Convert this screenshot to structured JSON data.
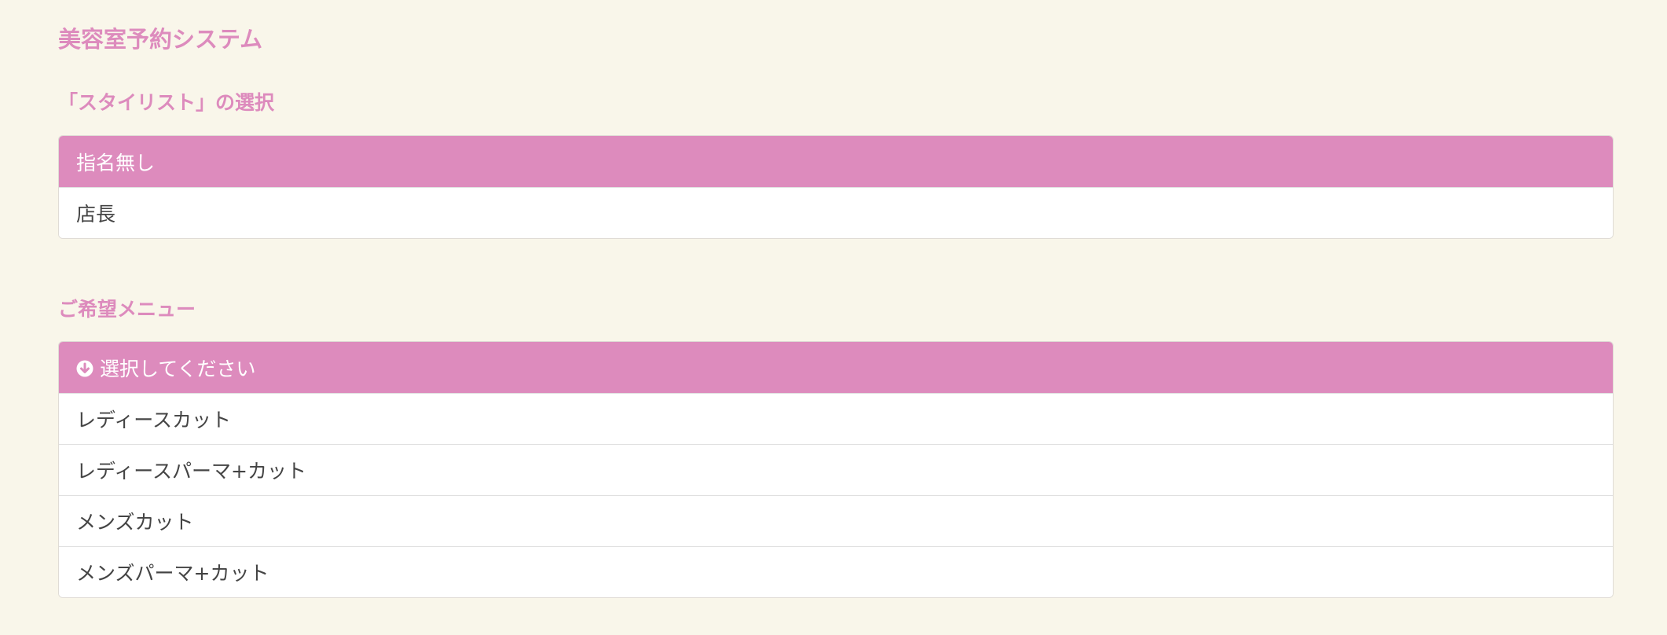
{
  "app": {
    "title": "美容室予約システム"
  },
  "stylist_section": {
    "title": "「スタイリスト」の選択",
    "items": [
      {
        "label": "指名無し",
        "selected": true
      },
      {
        "label": "店長",
        "selected": false
      }
    ]
  },
  "menu_section": {
    "title": "ご希望メニュー",
    "header": {
      "label": "選択してください",
      "icon": "arrow-down-circle-icon"
    },
    "items": [
      {
        "label": "レディースカット"
      },
      {
        "label": "レディースパーマ+カット"
      },
      {
        "label": "メンズカット"
      },
      {
        "label": "メンズパーマ+カット"
      }
    ]
  },
  "colors": {
    "background": "#f9f6ea",
    "accent": "#dd8bbd",
    "text": "#444444",
    "item_background": "#ffffff"
  }
}
